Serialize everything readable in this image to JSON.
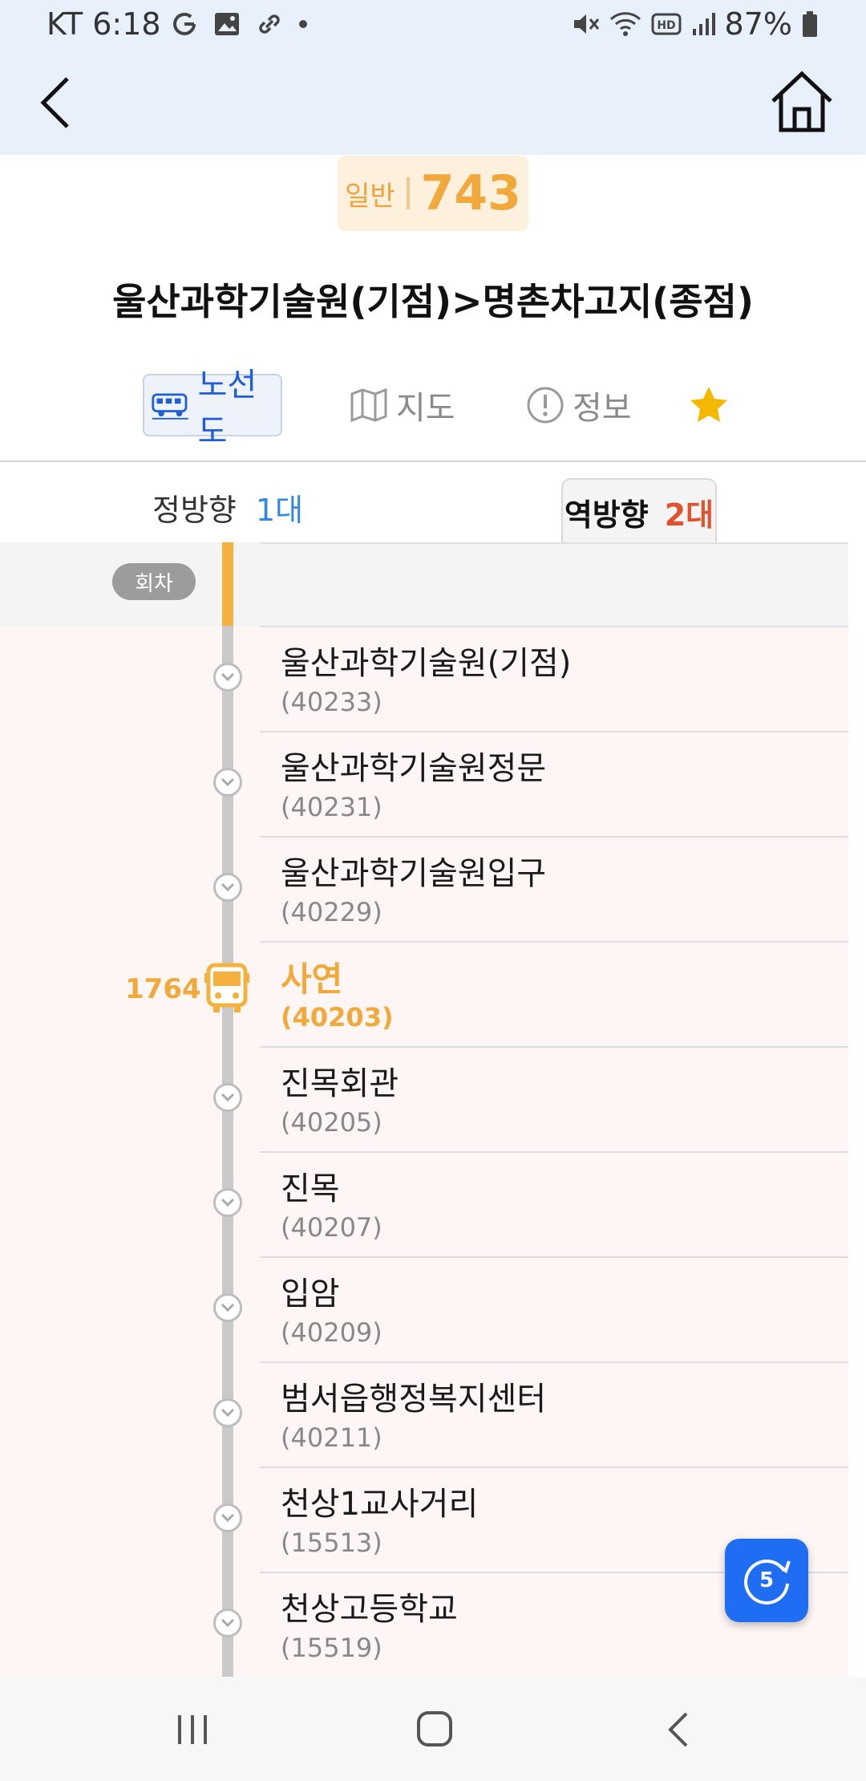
{
  "status_bar": {
    "carrier_time": "KT 6:18",
    "battery": "87%"
  },
  "route": {
    "type": "일반",
    "number": "743",
    "title": "울산과학기술원(기점)>명촌차고지(종점)"
  },
  "tabs": [
    {
      "label": "노선도",
      "icon": "bus-route-icon",
      "active": true
    },
    {
      "label": "지도",
      "icon": "map-icon",
      "active": false
    },
    {
      "label": "정보",
      "icon": "info-icon",
      "active": false
    }
  ],
  "directions": {
    "forward": {
      "label": "정방향",
      "count": "1대"
    },
    "reverse": {
      "label": "역방향",
      "count": "2대",
      "active": true
    }
  },
  "turn_label": "회차",
  "stops": [
    {
      "name": "울산과학기술원(기점)",
      "code": "(40233)"
    },
    {
      "name": "울산과학기술원정문",
      "code": "(40231)"
    },
    {
      "name": "울산과학기술원입구",
      "code": "(40229)"
    },
    {
      "name": "사연",
      "code": "(40203)",
      "bus": "1764"
    },
    {
      "name": "진목회관",
      "code": "(40205)"
    },
    {
      "name": "진목",
      "code": "(40207)"
    },
    {
      "name": "입암",
      "code": "(40209)"
    },
    {
      "name": "범서읍행정복지센터",
      "code": "(40211)"
    },
    {
      "name": "천상1교사거리",
      "code": "(15513)"
    },
    {
      "name": "천상고등학교",
      "code": "(15519)"
    }
  ],
  "refresh": {
    "countdown": "5"
  },
  "colors": {
    "accent_orange": "#f2a93b",
    "accent_blue": "#1f6df2",
    "reverse_count": "#e0522e",
    "forward_count": "#2f8ae0"
  }
}
